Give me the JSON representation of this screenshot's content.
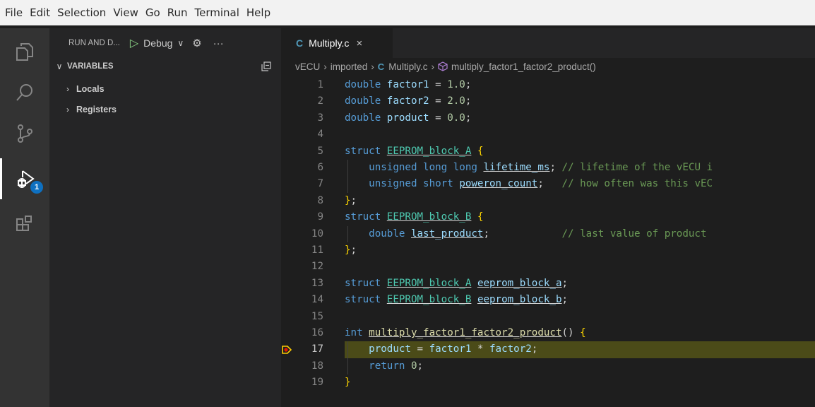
{
  "menu": [
    "File",
    "Edit",
    "Selection",
    "View",
    "Go",
    "Run",
    "Terminal",
    "Help"
  ],
  "activity_badge": "1",
  "sidebar": {
    "title": "RUN AND D...",
    "config": "Debug",
    "more": "···",
    "section": "VARIABLES",
    "items": [
      "Locals",
      "Registers"
    ]
  },
  "tab": {
    "label": "Multiply.c",
    "lang_icon": "C",
    "close": "×"
  },
  "breadcrumb": {
    "root": "vECU",
    "folder": "imported",
    "file": "Multiply.c",
    "symbol": "multiply_factor1_factor2_product()"
  },
  "editor": {
    "current_line": 17,
    "lines": [
      {
        "n": "1",
        "parts": [
          [
            "kw",
            "double"
          ],
          [
            "t",
            " "
          ],
          [
            "var",
            "factor1"
          ],
          [
            "t",
            " = "
          ],
          [
            "num",
            "1.0"
          ],
          [
            "t",
            ";"
          ]
        ]
      },
      {
        "n": "2",
        "parts": [
          [
            "kw",
            "double"
          ],
          [
            "t",
            " "
          ],
          [
            "var",
            "factor2"
          ],
          [
            "t",
            " = "
          ],
          [
            "num",
            "2.0"
          ],
          [
            "t",
            ";"
          ]
        ]
      },
      {
        "n": "3",
        "parts": [
          [
            "kw",
            "double"
          ],
          [
            "t",
            " "
          ],
          [
            "var",
            "product"
          ],
          [
            "t",
            " = "
          ],
          [
            "num",
            "0.0"
          ],
          [
            "t",
            ";"
          ]
        ]
      },
      {
        "n": "4",
        "parts": []
      },
      {
        "n": "5",
        "parts": [
          [
            "kw",
            "struct"
          ],
          [
            "t",
            " "
          ],
          [
            "ty",
            "EEPROM_block_A"
          ],
          [
            "t",
            " "
          ],
          [
            "br",
            "{"
          ]
        ]
      },
      {
        "n": "6",
        "parts": [
          [
            "t",
            "    "
          ],
          [
            "kw",
            "unsigned long long"
          ],
          [
            "t",
            " "
          ],
          [
            "var",
            "lifetime_ms"
          ],
          [
            "t",
            "; "
          ],
          [
            "cm",
            "// lifetime of the vECU i"
          ]
        ]
      },
      {
        "n": "7",
        "parts": [
          [
            "t",
            "    "
          ],
          [
            "kw",
            "unsigned short"
          ],
          [
            "t",
            " "
          ],
          [
            "var",
            "poweron_count"
          ],
          [
            "t",
            ";   "
          ],
          [
            "cm",
            "// how often was this vEC"
          ]
        ]
      },
      {
        "n": "8",
        "parts": [
          [
            "br",
            "}"
          ],
          [
            "t",
            ";"
          ]
        ]
      },
      {
        "n": "9",
        "parts": [
          [
            "kw",
            "struct"
          ],
          [
            "t",
            " "
          ],
          [
            "ty",
            "EEPROM_block_B"
          ],
          [
            "t",
            " "
          ],
          [
            "br",
            "{"
          ]
        ]
      },
      {
        "n": "10",
        "parts": [
          [
            "t",
            "    "
          ],
          [
            "kw",
            "double"
          ],
          [
            "t",
            " "
          ],
          [
            "var",
            "last_product"
          ],
          [
            "t",
            ";            "
          ],
          [
            "cm",
            "// last value of product"
          ]
        ]
      },
      {
        "n": "11",
        "parts": [
          [
            "br",
            "}"
          ],
          [
            "t",
            ";"
          ]
        ]
      },
      {
        "n": "12",
        "parts": []
      },
      {
        "n": "13",
        "parts": [
          [
            "kw",
            "struct"
          ],
          [
            "t",
            " "
          ],
          [
            "ty",
            "EEPROM_block_A"
          ],
          [
            "t",
            " "
          ],
          [
            "var",
            "eeprom_block_a"
          ],
          [
            "t",
            ";"
          ]
        ]
      },
      {
        "n": "14",
        "parts": [
          [
            "kw",
            "struct"
          ],
          [
            "t",
            " "
          ],
          [
            "ty",
            "EEPROM_block_B"
          ],
          [
            "t",
            " "
          ],
          [
            "var",
            "eeprom_block_b"
          ],
          [
            "t",
            ";"
          ]
        ]
      },
      {
        "n": "15",
        "parts": []
      },
      {
        "n": "16",
        "parts": [
          [
            "kw",
            "int"
          ],
          [
            "t",
            " "
          ],
          [
            "fn",
            "multiply_factor1_factor2_product"
          ],
          [
            "t",
            "() "
          ],
          [
            "br",
            "{"
          ]
        ]
      },
      {
        "n": "17",
        "parts": [
          [
            "t",
            "    "
          ],
          [
            "var",
            "product"
          ],
          [
            "t",
            " = "
          ],
          [
            "var",
            "factor1"
          ],
          [
            "t",
            " * "
          ],
          [
            "var",
            "factor2"
          ],
          [
            "t",
            ";"
          ]
        ]
      },
      {
        "n": "18",
        "parts": [
          [
            "t",
            "    "
          ],
          [
            "kw",
            "return"
          ],
          [
            "t",
            " "
          ],
          [
            "num",
            "0"
          ],
          [
            "t",
            ";"
          ]
        ]
      },
      {
        "n": "19",
        "parts": [
          [
            "br",
            "}"
          ]
        ]
      }
    ]
  }
}
